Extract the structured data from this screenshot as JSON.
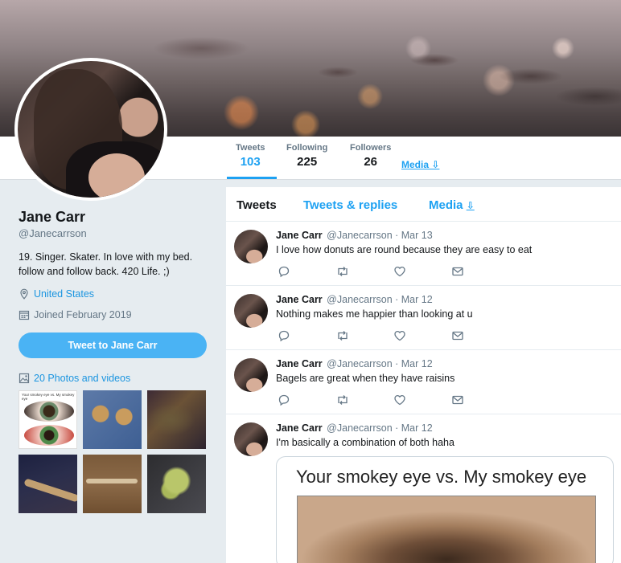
{
  "profile": {
    "name": "Jane Carr",
    "handle": "@Janecarrson",
    "bio": "19. Singer. Skater. In love with my bed. follow and follow back. 420 Life. ;)",
    "location": "United States",
    "joined": "Joined February 2019",
    "tweet_to_label": "Tweet to Jane Carr",
    "photos_label": "20 Photos and videos"
  },
  "nav": {
    "stats": [
      {
        "label": "Tweets",
        "value": "103"
      },
      {
        "label": "Following",
        "value": "225"
      },
      {
        "label": "Followers",
        "value": "26"
      }
    ],
    "media_label": "Media ⇩"
  },
  "timeline": {
    "tabs": [
      {
        "label": "Tweets"
      },
      {
        "label": "Tweets & replies"
      },
      {
        "label": "Media"
      }
    ],
    "tweets": [
      {
        "name": "Jane Carr",
        "handle": "@Janecarrson · Mar 13",
        "text": "I love how donuts are round because they are easy to eat"
      },
      {
        "name": "Jane Carr",
        "handle": "@Janecarrson · Mar 12",
        "text": "Nothing makes me happier than looking at u"
      },
      {
        "name": "Jane Carr",
        "handle": "@Janecarrson · Mar 12",
        "text": "Bagels are great when they have raisins"
      },
      {
        "name": "Jane Carr",
        "handle": "@Janecarrson · Mar 12",
        "text": "I'm basically a combination of both haha"
      }
    ],
    "meme_caption": "Your smokey eye vs. My smokey eye"
  },
  "thumbs": {
    "t1_caption": "Your smokey eye vs. My smokey eye"
  },
  "colors": {
    "accent": "#1da1f2",
    "button": "#4ab3f4",
    "background": "#e6ecf0"
  }
}
